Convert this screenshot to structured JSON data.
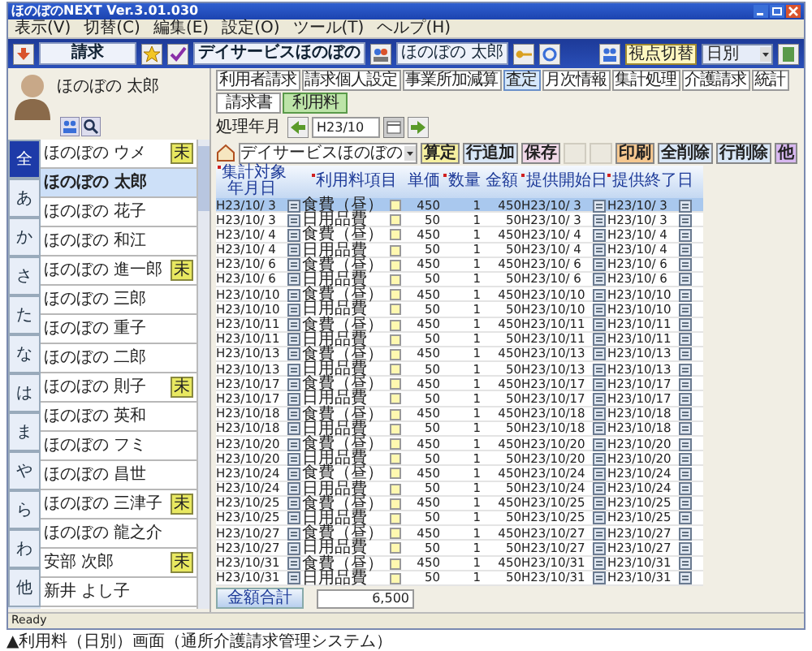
{
  "window": {
    "title": "ほのぼのNEXT Ver.3.01.030"
  },
  "menu": [
    "表示(V)",
    "切替(C)",
    "編集(E)",
    "設定(O)",
    "ツール(T)",
    "ヘルプ(H)"
  ],
  "toolbar": {
    "mode": "請求",
    "office": "デイサービスほのぼの",
    "user": "ほのぼの 太郎",
    "view_label": "視点切替",
    "view_value": "日別"
  },
  "client": {
    "name": "ほのぼの 太郎"
  },
  "tabs": [
    {
      "label": "利用者請求",
      "selected": false
    },
    {
      "label": "請求個人設定",
      "selected": false
    },
    {
      "label": "事業所加減算",
      "selected": false
    },
    {
      "label": "査定",
      "selected": true
    },
    {
      "label": "月次情報",
      "selected": false
    },
    {
      "label": "集計処理",
      "selected": false
    },
    {
      "label": "介護請求",
      "selected": false
    },
    {
      "label": "統計",
      "selected": false
    }
  ],
  "subtabs": [
    {
      "label": "請求書",
      "selected": false
    },
    {
      "label": "利用料",
      "selected": true
    }
  ],
  "period": {
    "label": "処理年月",
    "value": "H23/10"
  },
  "actions": {
    "office": "デイサービスほのぼの",
    "buttons": [
      {
        "label": "算定",
        "kind": "calc"
      },
      {
        "label": "行追加",
        "kind": "edit"
      },
      {
        "label": "保存",
        "kind": "save"
      },
      {
        "label": "印刷",
        "kind": "print"
      },
      {
        "label": "全削除",
        "kind": "edit"
      },
      {
        "label": "行削除",
        "kind": "edit"
      },
      {
        "label": "他",
        "kind": "other"
      }
    ]
  },
  "index": [
    {
      "label": "全",
      "selected": true
    },
    {
      "label": "あ",
      "selected": false
    },
    {
      "label": "か",
      "selected": false
    },
    {
      "label": "さ",
      "selected": false
    },
    {
      "label": "た",
      "selected": false
    },
    {
      "label": "な",
      "selected": false
    },
    {
      "label": "は",
      "selected": false
    },
    {
      "label": "ま",
      "selected": false
    },
    {
      "label": "や",
      "selected": false
    },
    {
      "label": "ら",
      "selected": false
    },
    {
      "label": "わ",
      "selected": false
    },
    {
      "label": "他",
      "selected": false
    }
  ],
  "clients": [
    {
      "name": "ほのぼの ウメ",
      "selected": false,
      "badge": "未"
    },
    {
      "name": "ほのぼの 太郎",
      "selected": true
    },
    {
      "name": "ほのぼの 花子",
      "selected": false
    },
    {
      "name": "ほのぼの 和江",
      "selected": false
    },
    {
      "name": "ほのぼの 進一郎",
      "selected": false,
      "badge": "未"
    },
    {
      "name": "ほのぼの 三郎",
      "selected": false
    },
    {
      "name": "ほのぼの 重子",
      "selected": false
    },
    {
      "name": "ほのぼの 二郎",
      "selected": false
    },
    {
      "name": "ほのぼの 則子",
      "selected": false,
      "badge": "未"
    },
    {
      "name": "ほのぼの 英和",
      "selected": false
    },
    {
      "name": "ほのぼの フミ",
      "selected": false
    },
    {
      "name": "ほのぼの 昌世",
      "selected": false
    },
    {
      "name": "ほのぼの 三津子",
      "selected": false,
      "badge": "未"
    },
    {
      "name": "ほのぼの 龍之介",
      "selected": false
    },
    {
      "name": "安部 次郎",
      "selected": false,
      "badge": "未"
    },
    {
      "name": "新井 よし子",
      "selected": false
    }
  ],
  "table": {
    "columns": [
      {
        "label": "集計対象年月日",
        "required": true
      },
      {
        "label": "利用料項目",
        "required": true
      },
      {
        "label": "単価",
        "required": false
      },
      {
        "label": "数量",
        "required": true
      },
      {
        "label": "金額",
        "required": false
      },
      {
        "label": "提供開始日",
        "required": true
      },
      {
        "label": "提供終了日",
        "required": true
      }
    ],
    "rows": [
      {
        "date": "H23/10/ 3",
        "item": "食費（昼）",
        "price": "450",
        "qty": "1",
        "amount": "450",
        "start": "H23/10/ 3",
        "end": "H23/10/ 3",
        "selected": true
      },
      {
        "date": "H23/10/ 3",
        "item": "日用品費",
        "price": "50",
        "qty": "1",
        "amount": "50",
        "start": "H23/10/ 3",
        "end": "H23/10/ 3",
        "selected": false
      },
      {
        "date": "H23/10/ 4",
        "item": "食費（昼）",
        "price": "450",
        "qty": "1",
        "amount": "450",
        "start": "H23/10/ 4",
        "end": "H23/10/ 4",
        "selected": false
      },
      {
        "date": "H23/10/ 4",
        "item": "日用品費",
        "price": "50",
        "qty": "1",
        "amount": "50",
        "start": "H23/10/ 4",
        "end": "H23/10/ 4",
        "selected": false
      },
      {
        "date": "H23/10/ 6",
        "item": "食費（昼）",
        "price": "450",
        "qty": "1",
        "amount": "450",
        "start": "H23/10/ 6",
        "end": "H23/10/ 6",
        "selected": false
      },
      {
        "date": "H23/10/ 6",
        "item": "日用品費",
        "price": "50",
        "qty": "1",
        "amount": "50",
        "start": "H23/10/ 6",
        "end": "H23/10/ 6",
        "selected": false
      },
      {
        "date": "H23/10/10",
        "item": "食費（昼）",
        "price": "450",
        "qty": "1",
        "amount": "450",
        "start": "H23/10/10",
        "end": "H23/10/10",
        "selected": false
      },
      {
        "date": "H23/10/10",
        "item": "日用品費",
        "price": "50",
        "qty": "1",
        "amount": "50",
        "start": "H23/10/10",
        "end": "H23/10/10",
        "selected": false
      },
      {
        "date": "H23/10/11",
        "item": "食費（昼）",
        "price": "450",
        "qty": "1",
        "amount": "450",
        "start": "H23/10/11",
        "end": "H23/10/11",
        "selected": false
      },
      {
        "date": "H23/10/11",
        "item": "日用品費",
        "price": "50",
        "qty": "1",
        "amount": "50",
        "start": "H23/10/11",
        "end": "H23/10/11",
        "selected": false
      },
      {
        "date": "H23/10/13",
        "item": "食費（昼）",
        "price": "450",
        "qty": "1",
        "amount": "450",
        "start": "H23/10/13",
        "end": "H23/10/13",
        "selected": false
      },
      {
        "date": "H23/10/13",
        "item": "日用品費",
        "price": "50",
        "qty": "1",
        "amount": "50",
        "start": "H23/10/13",
        "end": "H23/10/13",
        "selected": false
      },
      {
        "date": "H23/10/17",
        "item": "食費（昼）",
        "price": "450",
        "qty": "1",
        "amount": "450",
        "start": "H23/10/17",
        "end": "H23/10/17",
        "selected": false
      },
      {
        "date": "H23/10/17",
        "item": "日用品費",
        "price": "50",
        "qty": "1",
        "amount": "50",
        "start": "H23/10/17",
        "end": "H23/10/17",
        "selected": false
      },
      {
        "date": "H23/10/18",
        "item": "食費（昼）",
        "price": "450",
        "qty": "1",
        "amount": "450",
        "start": "H23/10/18",
        "end": "H23/10/18",
        "selected": false
      },
      {
        "date": "H23/10/18",
        "item": "日用品費",
        "price": "50",
        "qty": "1",
        "amount": "50",
        "start": "H23/10/18",
        "end": "H23/10/18",
        "selected": false
      },
      {
        "date": "H23/10/20",
        "item": "食費（昼）",
        "price": "450",
        "qty": "1",
        "amount": "450",
        "start": "H23/10/20",
        "end": "H23/10/20",
        "selected": false
      },
      {
        "date": "H23/10/20",
        "item": "日用品費",
        "price": "50",
        "qty": "1",
        "amount": "50",
        "start": "H23/10/20",
        "end": "H23/10/20",
        "selected": false
      },
      {
        "date": "H23/10/24",
        "item": "食費（昼）",
        "price": "450",
        "qty": "1",
        "amount": "450",
        "start": "H23/10/24",
        "end": "H23/10/24",
        "selected": false
      },
      {
        "date": "H23/10/24",
        "item": "日用品費",
        "price": "50",
        "qty": "1",
        "amount": "50",
        "start": "H23/10/24",
        "end": "H23/10/24",
        "selected": false
      },
      {
        "date": "H23/10/25",
        "item": "食費（昼）",
        "price": "450",
        "qty": "1",
        "amount": "450",
        "start": "H23/10/25",
        "end": "H23/10/25",
        "selected": false
      },
      {
        "date": "H23/10/25",
        "item": "日用品費",
        "price": "50",
        "qty": "1",
        "amount": "50",
        "start": "H23/10/25",
        "end": "H23/10/25",
        "selected": false
      },
      {
        "date": "H23/10/27",
        "item": "食費（昼）",
        "price": "450",
        "qty": "1",
        "amount": "450",
        "start": "H23/10/27",
        "end": "H23/10/27",
        "selected": false
      },
      {
        "date": "H23/10/27",
        "item": "日用品費",
        "price": "50",
        "qty": "1",
        "amount": "50",
        "start": "H23/10/27",
        "end": "H23/10/27",
        "selected": false
      },
      {
        "date": "H23/10/31",
        "item": "食費（昼）",
        "price": "450",
        "qty": "1",
        "amount": "450",
        "start": "H23/10/31",
        "end": "H23/10/31",
        "selected": false
      },
      {
        "date": "H23/10/31",
        "item": "日用品費",
        "price": "50",
        "qty": "1",
        "amount": "50",
        "start": "H23/10/31",
        "end": "H23/10/31",
        "selected": false
      }
    ]
  },
  "total": {
    "label": "金額合計",
    "value": "6,500"
  },
  "status_bar": "Ready",
  "caption": "▲利用料（日別）画面（通所介護請求管理システム）"
}
